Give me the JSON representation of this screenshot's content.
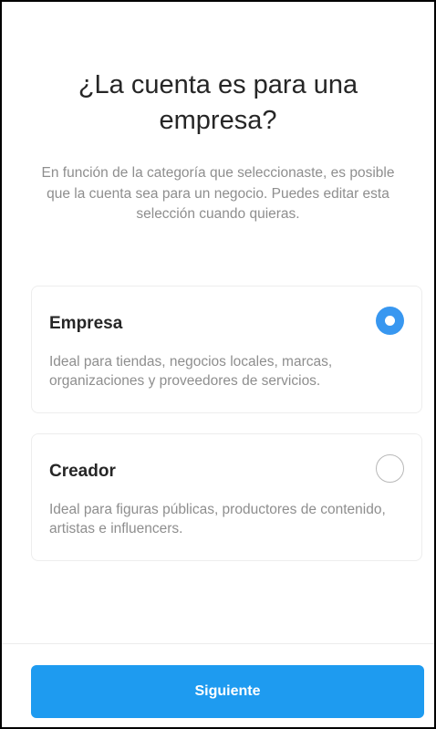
{
  "header": {
    "title": "¿La cuenta es para una empresa?",
    "subtitle": "En función de la categoría que seleccionaste, es posible que la cuenta sea para un negocio. Puedes editar esta selección cuando quieras."
  },
  "options": [
    {
      "title": "Empresa",
      "description": "Ideal para tiendas, negocios locales, marcas, organizaciones y proveedores de servicios.",
      "selected": true
    },
    {
      "title": "Creador",
      "description": "Ideal para figuras públicas, productores de contenido, artistas e influencers.",
      "selected": false
    }
  ],
  "footer": {
    "next_label": "Siguiente"
  },
  "colors": {
    "accent": "#3897f0",
    "button": "#1e9bf0",
    "text_primary": "#262626",
    "text_secondary": "#8e8e8e"
  }
}
